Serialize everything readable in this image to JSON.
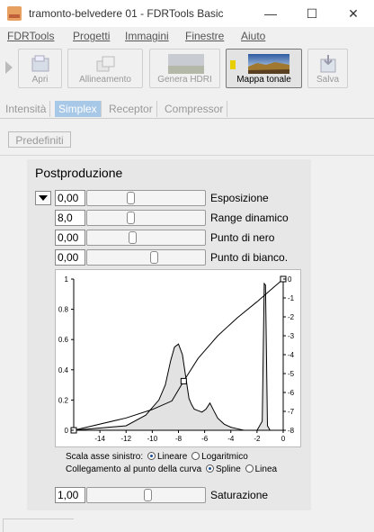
{
  "window": {
    "title": "tramonto-belvedere 01 - FDRTools Basic"
  },
  "menu": [
    "FDRTools",
    "Progetti",
    "Immagini",
    "Finestre",
    "Aiuto"
  ],
  "toolbar": {
    "open": "Apri",
    "align": "Allineamento",
    "hdri": "Genera HDRI",
    "tonemap": "Mappa tonale",
    "save": "Salva"
  },
  "tabs": [
    "Intensità",
    "Simplex",
    "Receptor",
    "Compressor"
  ],
  "presets_label": "Predefiniti",
  "section_title": "Postproduzione",
  "sliders": {
    "exposure": {
      "value": "0,00",
      "label": "Esposizione",
      "level": 0.36
    },
    "dynamic_range": {
      "value": "8,0",
      "label": "Range dinamico",
      "level": 0.36
    },
    "black_point": {
      "value": "0,00",
      "label": "Punto di nero",
      "level": 0.38
    },
    "white_point": {
      "value": "0,00",
      "label": "Punto di bianco.",
      "level": 0.57
    },
    "saturation": {
      "value": "1,00",
      "label": "Saturazione",
      "level": 0.52
    }
  },
  "chart_data": {
    "type": "area",
    "xlim": [
      -16,
      0
    ],
    "ylim_left": [
      0,
      1
    ],
    "ylim_right": [
      -8,
      0
    ],
    "x_ticks": [
      -14,
      -12,
      -10,
      -8,
      -6,
      -4,
      -2,
      0
    ],
    "y_left_ticks": [
      0,
      0.2,
      0.4,
      0.6,
      0.8,
      1
    ],
    "y_right_ticks": [
      0,
      -1,
      -2,
      -3,
      -4,
      -5,
      -6,
      -7,
      -8
    ],
    "histogram": {
      "x": [
        -16,
        -12,
        -10.5,
        -9.5,
        -9,
        -8.6,
        -8.3,
        -8.0,
        -7.7,
        -7.4,
        -7.2,
        -7.0,
        -6.8,
        -6.5,
        -6.2,
        -5.9,
        -5.6,
        -5.3,
        -5.0,
        -4.5,
        -4.0,
        -3.5,
        -3.0,
        -2.5,
        -2.0,
        -1.8,
        -1.6,
        -1.45,
        -1.35,
        -1.2,
        -1.0,
        0
      ],
      "y": [
        0,
        0.03,
        0.1,
        0.2,
        0.3,
        0.46,
        0.55,
        0.57,
        0.5,
        0.33,
        0.21,
        0.17,
        0.14,
        0.13,
        0.12,
        0.14,
        0.18,
        0.13,
        0.08,
        0.04,
        0.02,
        0.01,
        0.0,
        0.0,
        0.0,
        0.03,
        0.06,
        0.97,
        0.96,
        0.03,
        0.0,
        0.0
      ]
    },
    "curve": {
      "x": [
        -16,
        -12,
        -10,
        -8.5,
        -7.6,
        -6.5,
        -5,
        -3.5,
        -2,
        -1,
        0
      ],
      "y": [
        -8,
        -7.35,
        -6.9,
        -6.45,
        -5.4,
        -4.2,
        -3.0,
        -2.05,
        -1.2,
        -0.6,
        0
      ]
    },
    "control_points": {
      "x": [
        -16,
        -7.6,
        0
      ],
      "y": [
        -8,
        -5.4,
        0
      ]
    }
  },
  "axis_options": {
    "scale_label": "Scala asse sinistro:",
    "linear": "Lineare",
    "log": "Logaritmico",
    "link_label": "Collegamento al punto della curva",
    "spline": "Spline",
    "line": "Linea"
  }
}
